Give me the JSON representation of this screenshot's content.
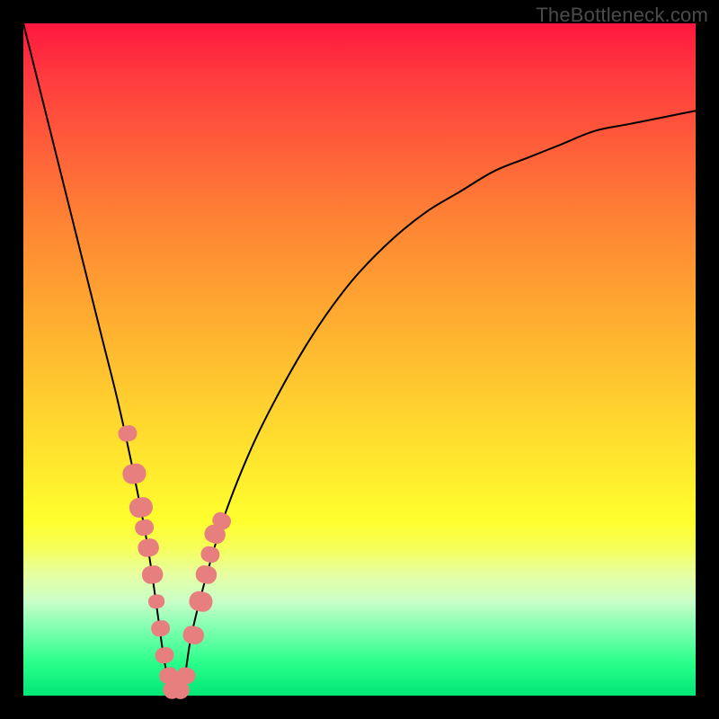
{
  "watermark": "TheBottleneck.com",
  "colors": {
    "gradient_top": "#ff173f",
    "gradient_bottom": "#00e676",
    "line": "#000000",
    "marker": "#e77f7f",
    "frame": "#000000"
  },
  "chart_data": {
    "type": "line",
    "title": "",
    "xlabel": "",
    "ylabel": "",
    "xlim": [
      0,
      100
    ],
    "ylim": [
      0,
      100
    ],
    "grid": false,
    "series": [
      {
        "name": "bottleneck-curve",
        "x": [
          0,
          2,
          4,
          6,
          8,
          10,
          12,
          14,
          16,
          18,
          19,
          20,
          21,
          22,
          23,
          24,
          25,
          27,
          30,
          34,
          38,
          42,
          46,
          50,
          55,
          60,
          65,
          70,
          75,
          80,
          85,
          90,
          95,
          100
        ],
        "values": [
          100,
          92,
          84,
          76,
          68,
          60,
          52,
          44,
          35,
          25,
          19,
          12,
          5,
          1,
          1,
          3,
          9,
          17,
          27,
          37,
          45,
          52,
          58,
          63,
          68,
          72,
          75,
          78,
          80,
          82,
          84,
          85,
          86,
          87
        ]
      }
    ],
    "markers": {
      "name": "highlighted-points",
      "x": [
        15.5,
        16.5,
        17.5,
        18.0,
        18.6,
        19.2,
        19.8,
        20.4,
        21.0,
        21.6,
        22.3,
        23.2,
        24.2,
        25.3,
        26.4,
        27.2,
        27.8,
        28.5,
        29.5
      ],
      "values": [
        39,
        33,
        28,
        25,
        22,
        18,
        14,
        10,
        6,
        3,
        1,
        1,
        3,
        9,
        14,
        18,
        21,
        24,
        26
      ],
      "sizes": [
        8,
        10,
        10,
        8,
        9,
        9,
        7,
        8,
        8,
        8,
        9,
        9,
        8,
        9,
        10,
        9,
        8,
        9,
        8
      ]
    }
  }
}
